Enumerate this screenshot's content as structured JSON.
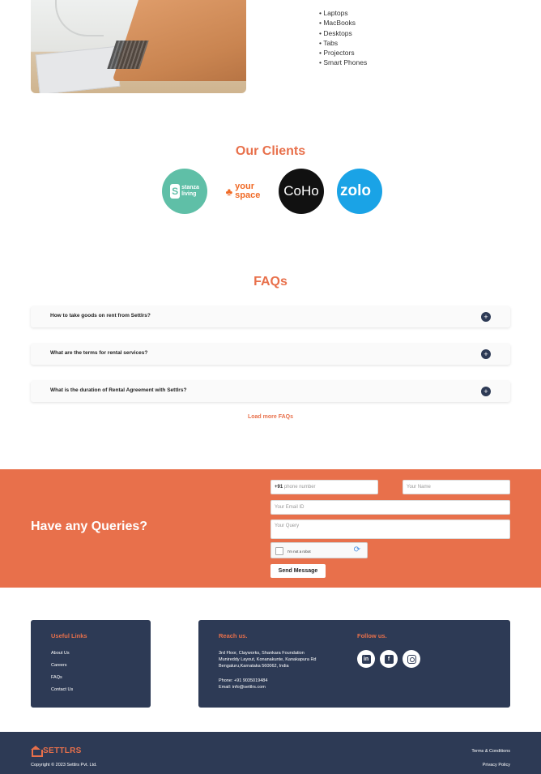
{
  "products": {
    "list_header_partial": "",
    "items": [
      "Laptops",
      "MacBooks",
      "Desktops",
      "Tabs",
      "Projectors",
      "Smart Phones"
    ]
  },
  "clients": {
    "title": "Our Clients",
    "logos": [
      {
        "name": "stanza living",
        "line1": "stanza",
        "line2": "living"
      },
      {
        "name": "your space",
        "line1": "your",
        "line2": "space"
      },
      {
        "name": "CoHo",
        "text": "CoHo"
      },
      {
        "name": "zolo",
        "text": "zolo"
      }
    ]
  },
  "faqs": {
    "title": "FAQs",
    "items": [
      {
        "question": "How to take goods on rent from Settlrs?"
      },
      {
        "question": "What are the terms for rental services?"
      },
      {
        "question": "What is the duration of Rental Agreement with Settlrs?"
      }
    ],
    "load_more": "Load more FAQs"
  },
  "queries": {
    "title": "Have any Queries?",
    "phone_prefix": "+91",
    "phone_placeholder": "phone number",
    "name_placeholder": "Your Name",
    "email_placeholder": "Your Email ID",
    "query_placeholder": "Your Query",
    "captcha_label": "I'm not a robot",
    "send_label": "Send Message"
  },
  "footer": {
    "useful_links": {
      "title": "Useful Links",
      "items": [
        "About Us",
        "Careers",
        "FAQs",
        "Contact Us"
      ]
    },
    "reach_us": {
      "title": "Reach us.",
      "address_line1": "3rd Floor, Clayworks, Shankara Foundation",
      "address_line2": "Munireddy Layout, Konanakunte, Kanakapura Rd",
      "address_line3": "Bengaluru,Karnataka 560062, India",
      "phone": "Phone: +91 9035019484",
      "email": "Email: info@settlrs.com"
    },
    "follow_us": {
      "title": "Follow us.",
      "icons": [
        "linkedin-icon",
        "facebook-icon",
        "instagram-icon"
      ]
    }
  },
  "bottom_bar": {
    "brand": "SETTLRS",
    "copyright": "Copyright © 2023 Settlrs Pvt. Ltd.",
    "terms": "Terms & Conditions",
    "privacy": "Privacy Policy"
  },
  "colors": {
    "accent": "#e8704b",
    "navy": "#2d3a55"
  }
}
